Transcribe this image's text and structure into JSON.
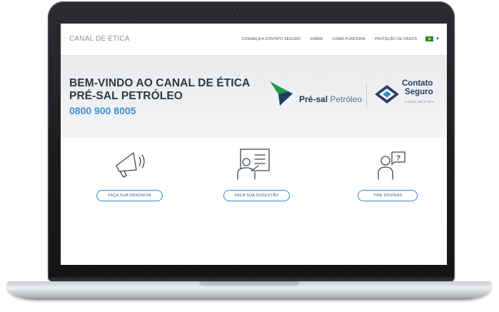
{
  "header": {
    "brand": "CANAL DE ÉTICA",
    "nav": [
      "CONHEÇA A CONTATO SEGURO",
      "SOBRE",
      "COMO FUNCIONA",
      "PROTEÇÃO DE DADOS"
    ]
  },
  "hero": {
    "title_line1": "BEM-VINDO AO CANAL DE ÉTICA",
    "title_line2": "PRÉ-SAL PETRÓLEO",
    "phone": "0800 900 8005",
    "partner_logo": {
      "part1": "Pré-sal",
      "part2": "Petróleo"
    },
    "provider_logo": {
      "line1": "Contato",
      "line2": "Seguro",
      "sub": "CANAL DE ÉTICA"
    }
  },
  "actions": [
    {
      "label": "FAÇA SUA DENÚNCIA",
      "icon": "megaphone-icon"
    },
    {
      "label": "FAÇA SUA SUGESTÃO",
      "icon": "presentation-icon"
    },
    {
      "label": "TIRE DÚVIDAS",
      "icon": "question-bubble-icon"
    }
  ],
  "colors": {
    "accent": "#3a87cf",
    "title": "#2c3a46",
    "phone": "#3b8fdc",
    "provider": "#2a3f63",
    "hero_bg": "#eeeff1"
  }
}
